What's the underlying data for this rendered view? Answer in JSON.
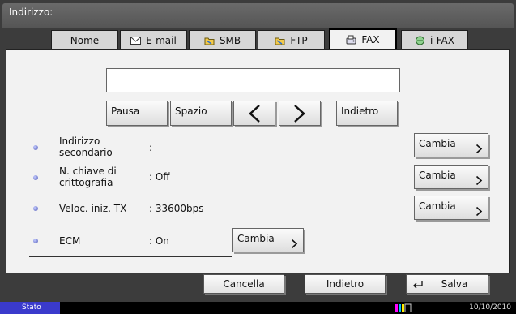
{
  "window": {
    "title": "Indirizzo:"
  },
  "tabs": [
    {
      "label": "Nome",
      "icon": ""
    },
    {
      "label": "E-mail",
      "icon": "mail-icon"
    },
    {
      "label": "SMB",
      "icon": "folder-icon"
    },
    {
      "label": "FTP",
      "icon": "folder-icon"
    },
    {
      "label": "FAX",
      "icon": "fax-icon",
      "active": true
    },
    {
      "label": "i-FAX",
      "icon": "ifax-icon"
    }
  ],
  "number_field": {
    "value": ""
  },
  "keypad": {
    "pause": "Pausa",
    "space": "Spazio",
    "back": "Indietro"
  },
  "rows": [
    {
      "label_line1": "Indirizzo",
      "label_line2": "secondario",
      "value": ":",
      "button": "Cambia"
    },
    {
      "label_line1": "N. chiave di",
      "label_line2": "crittografia",
      "value": ": Off",
      "button": "Cambia"
    },
    {
      "label_line1": "Veloc. iniz. TX",
      "label_line2": "",
      "value": ": 33600bps",
      "button": "Cambia"
    },
    {
      "label_line1": "ECM",
      "label_line2": "",
      "value": ": On",
      "button": "Cambia"
    }
  ],
  "footer": {
    "cancel": "Cancella",
    "back": "Indietro",
    "save": "Salva"
  },
  "status": {
    "label": "Stato",
    "date": "10/10/2010"
  },
  "colors": {
    "status_accent": "#3a3acc",
    "bullet": "#5a63b8"
  }
}
